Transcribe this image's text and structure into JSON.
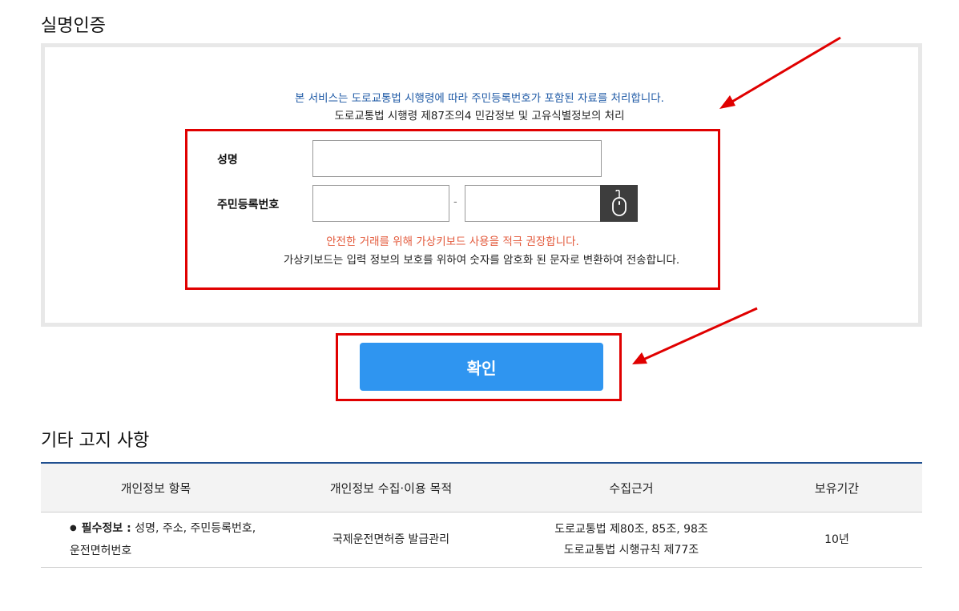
{
  "auth_title": "실명인증",
  "notice": {
    "line1": "본 서비스는 도로교통법 시행령에 따라 주민등록번호가 포함된 자료를 처리합니다.",
    "line2": "도로교통법 시행령 제87조의4 민감정보 및 고유식별정보의 처리"
  },
  "form": {
    "name_label": "성명",
    "name_value": "",
    "rrn_label": "주민등록번호",
    "rrn_first_value": "",
    "rrn_second_value": "",
    "dash": "-",
    "keyboard_icon": "mouse-icon"
  },
  "warnings": {
    "red": "안전한 거래를 위해 가상키보드 사용을 적극 권장합니다.",
    "black": "가상키보드는 입력 정보의 보호를 위하여 숫자를 암호화 된 문자로 변환하여 전송합니다."
  },
  "confirm_label": "확인",
  "other_notice": {
    "title": "기타 고지 사항",
    "headers": [
      "개인정보 항목",
      "개인정보 수집·이용 목적",
      "수집근거",
      "보유기간"
    ],
    "row": {
      "items_label": "필수정보 :",
      "items_text": " 성명, 주소, 주민등록번호,",
      "items_text2": "운전면허번호",
      "purpose": "국제운전면허증 발급관리",
      "basis_line1": "도로교통법 제80조, 85조, 98조",
      "basis_line2": "도로교통법 시행규칙 제77조",
      "retention": "10년"
    }
  },
  "colors": {
    "annotation_red": "#e00000",
    "notice_blue": "#1f5aa6",
    "warning_red": "#e35a3c",
    "confirm_blue": "#2f95f0",
    "table_border": "#1f4f8f"
  }
}
